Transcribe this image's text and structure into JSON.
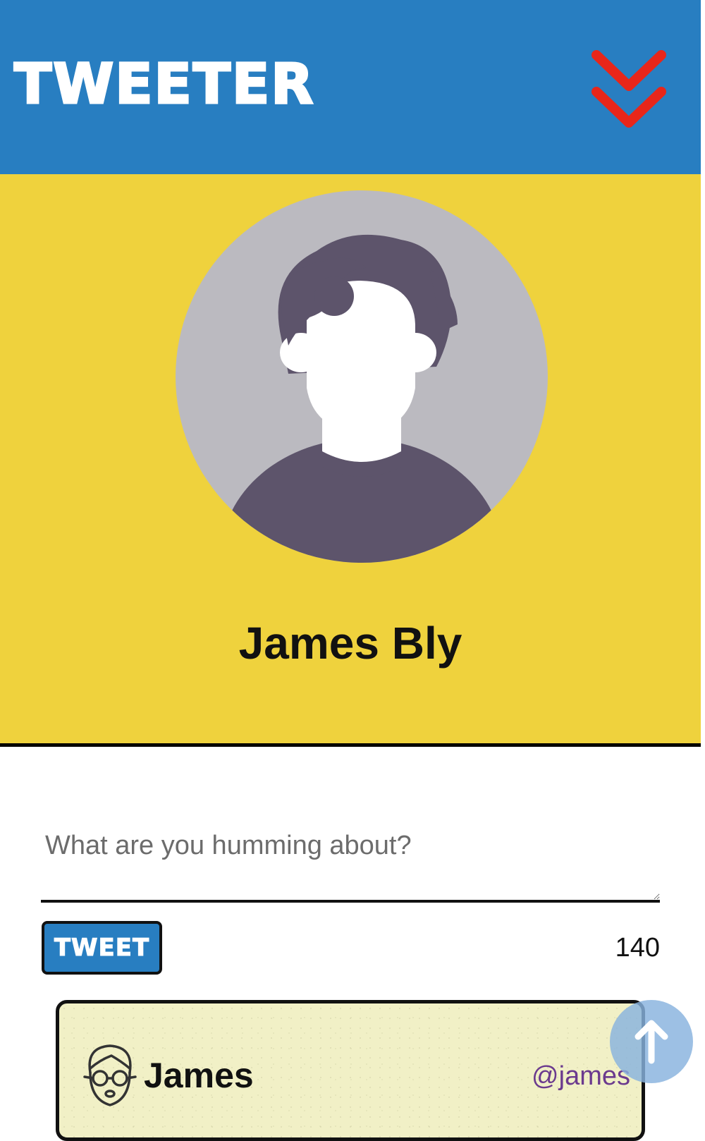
{
  "header": {
    "logo_text": "TWEETER",
    "menu_icon": "double-chevron-down-icon",
    "menu_icon_color": "#e8261a",
    "background": "#287ec1"
  },
  "profile": {
    "name": "James Bly",
    "avatar_icon": "user-avatar-placeholder",
    "background": "#efd23d"
  },
  "composer": {
    "placeholder": "What are you humming about?",
    "value": "",
    "tweet_button_label": "TWEET",
    "char_count": "140"
  },
  "tweets": [
    {
      "name": "James",
      "handle": "@james",
      "avatar_icon": "face-with-glasses-icon"
    }
  ],
  "scroll_top_icon": "arrow-up-icon"
}
